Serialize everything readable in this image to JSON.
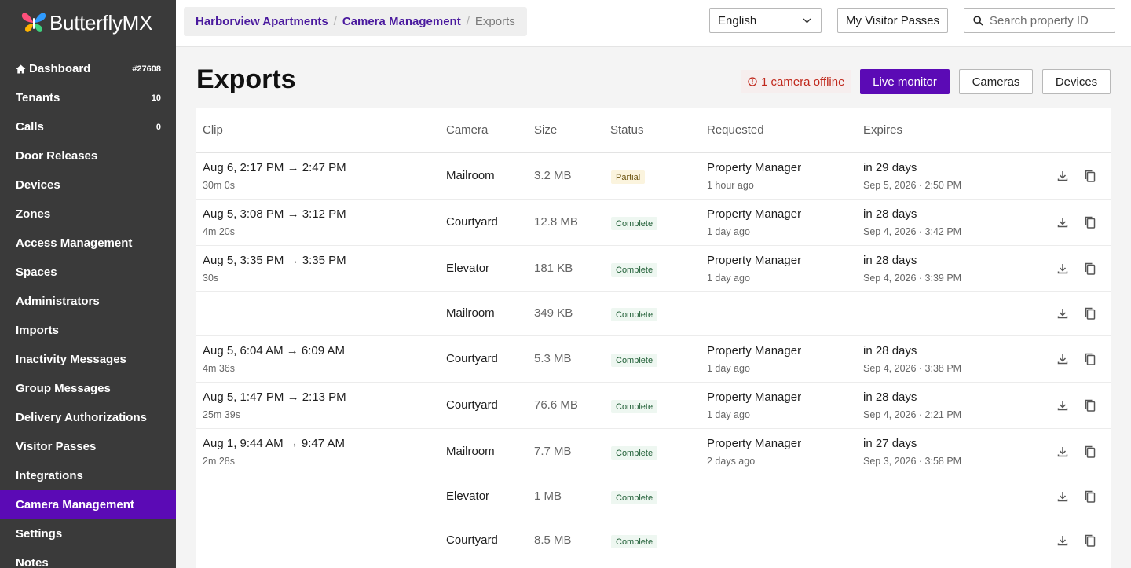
{
  "brand": {
    "name": "ButterflyMX"
  },
  "sidebar": {
    "items": [
      {
        "label": "Dashboard",
        "badge": "#27608",
        "icon": "home-icon"
      },
      {
        "label": "Tenants",
        "badge": "10"
      },
      {
        "label": "Calls",
        "badge": "0"
      },
      {
        "label": "Door Releases",
        "badge": ""
      },
      {
        "label": "Devices",
        "badge": ""
      },
      {
        "label": "Zones",
        "badge": ""
      },
      {
        "label": "Access Management",
        "badge": ""
      },
      {
        "label": "Spaces",
        "badge": ""
      },
      {
        "label": "Administrators",
        "badge": ""
      },
      {
        "label": "Imports",
        "badge": ""
      },
      {
        "label": "Inactivity Messages",
        "badge": ""
      },
      {
        "label": "Group Messages",
        "badge": ""
      },
      {
        "label": "Delivery Authorizations",
        "badge": ""
      },
      {
        "label": "Visitor Passes",
        "badge": ""
      },
      {
        "label": "Integrations",
        "badge": ""
      },
      {
        "label": "Camera Management",
        "badge": "",
        "active": true
      },
      {
        "label": "Settings",
        "badge": ""
      },
      {
        "label": "Notes",
        "badge": ""
      }
    ]
  },
  "header": {
    "breadcrumb": {
      "property": "Harborview Apartments",
      "section": "Camera Management",
      "current": "Exports"
    },
    "language": "English",
    "visitor_passes_label": "My Visitor Passes",
    "search_placeholder": "Search property ID"
  },
  "page": {
    "title": "Exports",
    "offline_notice": "1 camera offline",
    "live_monitor_label": "Live monitor",
    "cameras_label": "Cameras",
    "devices_label": "Devices"
  },
  "table": {
    "columns": [
      "Clip",
      "Camera",
      "Size",
      "Status",
      "Requested",
      "Expires"
    ],
    "rows": [
      {
        "clip": "Aug 6, 2:17 PM → 2:47 PM",
        "duration": "30m 0s",
        "camera": "Mailroom",
        "size": "3.2 MB",
        "status": "Partial",
        "requested_by": "Property Manager",
        "requested_ago": "1 hour ago",
        "expires_in": "in 29 days",
        "expires_at": "Sep 5, 2026 · 2:50 PM"
      },
      {
        "clip": "Aug 5, 3:08 PM → 3:12 PM",
        "duration": "4m 20s",
        "camera": "Courtyard",
        "size": "12.8 MB",
        "status": "Complete",
        "requested_by": "Property Manager",
        "requested_ago": "1 day ago",
        "expires_in": "in 28 days",
        "expires_at": "Sep 4, 2026 · 3:42 PM"
      },
      {
        "clip": "Aug 5, 3:35 PM → 3:35 PM",
        "duration": "30s",
        "camera": "Elevator",
        "size": "181 KB",
        "status": "Complete",
        "requested_by": "Property Manager",
        "requested_ago": "1 day ago",
        "expires_in": "in 28 days",
        "expires_at": "Sep 4, 2026 · 3:39 PM"
      },
      {
        "clip": "",
        "duration": "",
        "camera": "Mailroom",
        "size": "349 KB",
        "status": "Complete",
        "requested_by": "",
        "requested_ago": "",
        "expires_in": "",
        "expires_at": ""
      },
      {
        "clip": "Aug 5, 6:04 AM → 6:09 AM",
        "duration": "4m 36s",
        "camera": "Courtyard",
        "size": "5.3 MB",
        "status": "Complete",
        "requested_by": "Property Manager",
        "requested_ago": "1 day ago",
        "expires_in": "in 28 days",
        "expires_at": "Sep 4, 2026 · 3:38 PM"
      },
      {
        "clip": "Aug 5, 1:47 PM → 2:13 PM",
        "duration": "25m 39s",
        "camera": "Courtyard",
        "size": "76.6 MB",
        "status": "Complete",
        "requested_by": "Property Manager",
        "requested_ago": "1 day ago",
        "expires_in": "in 28 days",
        "expires_at": "Sep 4, 2026 · 2:21 PM"
      },
      {
        "clip": "Aug 1, 9:44 AM → 9:47 AM",
        "duration": "2m 28s",
        "camera": "Mailroom",
        "size": "7.7 MB",
        "status": "Complete",
        "requested_by": "Property Manager",
        "requested_ago": "2 days ago",
        "expires_in": "in 27 days",
        "expires_at": "Sep 3, 2026 · 3:58 PM"
      },
      {
        "clip": "",
        "duration": "",
        "camera": "Elevator",
        "size": "1 MB",
        "status": "Complete",
        "requested_by": "",
        "requested_ago": "",
        "expires_in": "",
        "expires_at": ""
      },
      {
        "clip": "",
        "duration": "",
        "camera": "Courtyard",
        "size": "8.5 MB",
        "status": "Complete",
        "requested_by": "",
        "requested_ago": "",
        "expires_in": "",
        "expires_at": ""
      }
    ]
  },
  "colors": {
    "accent": "#5b0ab5",
    "sidebar": "#3a3a3a",
    "offline": "#c0281c"
  }
}
